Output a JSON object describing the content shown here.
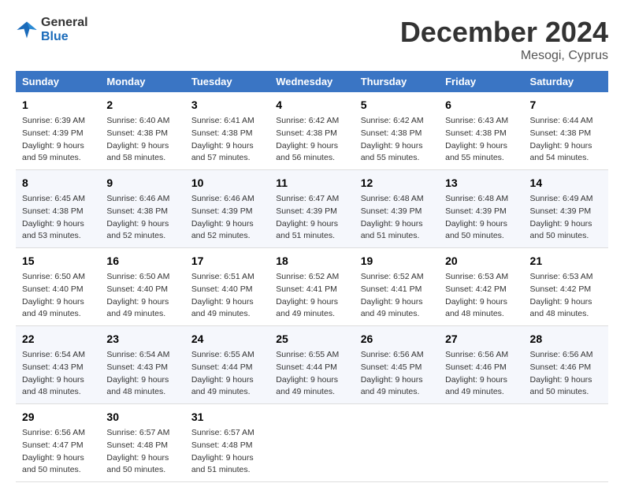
{
  "header": {
    "logo_line1": "General",
    "logo_line2": "Blue",
    "month_title": "December 2024",
    "location": "Mesogi, Cyprus"
  },
  "weekdays": [
    "Sunday",
    "Monday",
    "Tuesday",
    "Wednesday",
    "Thursday",
    "Friday",
    "Saturday"
  ],
  "weeks": [
    [
      {
        "day": "1",
        "sunrise": "Sunrise: 6:39 AM",
        "sunset": "Sunset: 4:39 PM",
        "daylight": "Daylight: 9 hours and 59 minutes."
      },
      {
        "day": "2",
        "sunrise": "Sunrise: 6:40 AM",
        "sunset": "Sunset: 4:38 PM",
        "daylight": "Daylight: 9 hours and 58 minutes."
      },
      {
        "day": "3",
        "sunrise": "Sunrise: 6:41 AM",
        "sunset": "Sunset: 4:38 PM",
        "daylight": "Daylight: 9 hours and 57 minutes."
      },
      {
        "day": "4",
        "sunrise": "Sunrise: 6:42 AM",
        "sunset": "Sunset: 4:38 PM",
        "daylight": "Daylight: 9 hours and 56 minutes."
      },
      {
        "day": "5",
        "sunrise": "Sunrise: 6:42 AM",
        "sunset": "Sunset: 4:38 PM",
        "daylight": "Daylight: 9 hours and 55 minutes."
      },
      {
        "day": "6",
        "sunrise": "Sunrise: 6:43 AM",
        "sunset": "Sunset: 4:38 PM",
        "daylight": "Daylight: 9 hours and 55 minutes."
      },
      {
        "day": "7",
        "sunrise": "Sunrise: 6:44 AM",
        "sunset": "Sunset: 4:38 PM",
        "daylight": "Daylight: 9 hours and 54 minutes."
      }
    ],
    [
      {
        "day": "8",
        "sunrise": "Sunrise: 6:45 AM",
        "sunset": "Sunset: 4:38 PM",
        "daylight": "Daylight: 9 hours and 53 minutes."
      },
      {
        "day": "9",
        "sunrise": "Sunrise: 6:46 AM",
        "sunset": "Sunset: 4:38 PM",
        "daylight": "Daylight: 9 hours and 52 minutes."
      },
      {
        "day": "10",
        "sunrise": "Sunrise: 6:46 AM",
        "sunset": "Sunset: 4:39 PM",
        "daylight": "Daylight: 9 hours and 52 minutes."
      },
      {
        "day": "11",
        "sunrise": "Sunrise: 6:47 AM",
        "sunset": "Sunset: 4:39 PM",
        "daylight": "Daylight: 9 hours and 51 minutes."
      },
      {
        "day": "12",
        "sunrise": "Sunrise: 6:48 AM",
        "sunset": "Sunset: 4:39 PM",
        "daylight": "Daylight: 9 hours and 51 minutes."
      },
      {
        "day": "13",
        "sunrise": "Sunrise: 6:48 AM",
        "sunset": "Sunset: 4:39 PM",
        "daylight": "Daylight: 9 hours and 50 minutes."
      },
      {
        "day": "14",
        "sunrise": "Sunrise: 6:49 AM",
        "sunset": "Sunset: 4:39 PM",
        "daylight": "Daylight: 9 hours and 50 minutes."
      }
    ],
    [
      {
        "day": "15",
        "sunrise": "Sunrise: 6:50 AM",
        "sunset": "Sunset: 4:40 PM",
        "daylight": "Daylight: 9 hours and 49 minutes."
      },
      {
        "day": "16",
        "sunrise": "Sunrise: 6:50 AM",
        "sunset": "Sunset: 4:40 PM",
        "daylight": "Daylight: 9 hours and 49 minutes."
      },
      {
        "day": "17",
        "sunrise": "Sunrise: 6:51 AM",
        "sunset": "Sunset: 4:40 PM",
        "daylight": "Daylight: 9 hours and 49 minutes."
      },
      {
        "day": "18",
        "sunrise": "Sunrise: 6:52 AM",
        "sunset": "Sunset: 4:41 PM",
        "daylight": "Daylight: 9 hours and 49 minutes."
      },
      {
        "day": "19",
        "sunrise": "Sunrise: 6:52 AM",
        "sunset": "Sunset: 4:41 PM",
        "daylight": "Daylight: 9 hours and 49 minutes."
      },
      {
        "day": "20",
        "sunrise": "Sunrise: 6:53 AM",
        "sunset": "Sunset: 4:42 PM",
        "daylight": "Daylight: 9 hours and 48 minutes."
      },
      {
        "day": "21",
        "sunrise": "Sunrise: 6:53 AM",
        "sunset": "Sunset: 4:42 PM",
        "daylight": "Daylight: 9 hours and 48 minutes."
      }
    ],
    [
      {
        "day": "22",
        "sunrise": "Sunrise: 6:54 AM",
        "sunset": "Sunset: 4:43 PM",
        "daylight": "Daylight: 9 hours and 48 minutes."
      },
      {
        "day": "23",
        "sunrise": "Sunrise: 6:54 AM",
        "sunset": "Sunset: 4:43 PM",
        "daylight": "Daylight: 9 hours and 48 minutes."
      },
      {
        "day": "24",
        "sunrise": "Sunrise: 6:55 AM",
        "sunset": "Sunset: 4:44 PM",
        "daylight": "Daylight: 9 hours and 49 minutes."
      },
      {
        "day": "25",
        "sunrise": "Sunrise: 6:55 AM",
        "sunset": "Sunset: 4:44 PM",
        "daylight": "Daylight: 9 hours and 49 minutes."
      },
      {
        "day": "26",
        "sunrise": "Sunrise: 6:56 AM",
        "sunset": "Sunset: 4:45 PM",
        "daylight": "Daylight: 9 hours and 49 minutes."
      },
      {
        "day": "27",
        "sunrise": "Sunrise: 6:56 AM",
        "sunset": "Sunset: 4:46 PM",
        "daylight": "Daylight: 9 hours and 49 minutes."
      },
      {
        "day": "28",
        "sunrise": "Sunrise: 6:56 AM",
        "sunset": "Sunset: 4:46 PM",
        "daylight": "Daylight: 9 hours and 50 minutes."
      }
    ],
    [
      {
        "day": "29",
        "sunrise": "Sunrise: 6:56 AM",
        "sunset": "Sunset: 4:47 PM",
        "daylight": "Daylight: 9 hours and 50 minutes."
      },
      {
        "day": "30",
        "sunrise": "Sunrise: 6:57 AM",
        "sunset": "Sunset: 4:48 PM",
        "daylight": "Daylight: 9 hours and 50 minutes."
      },
      {
        "day": "31",
        "sunrise": "Sunrise: 6:57 AM",
        "sunset": "Sunset: 4:48 PM",
        "daylight": "Daylight: 9 hours and 51 minutes."
      },
      null,
      null,
      null,
      null
    ]
  ]
}
